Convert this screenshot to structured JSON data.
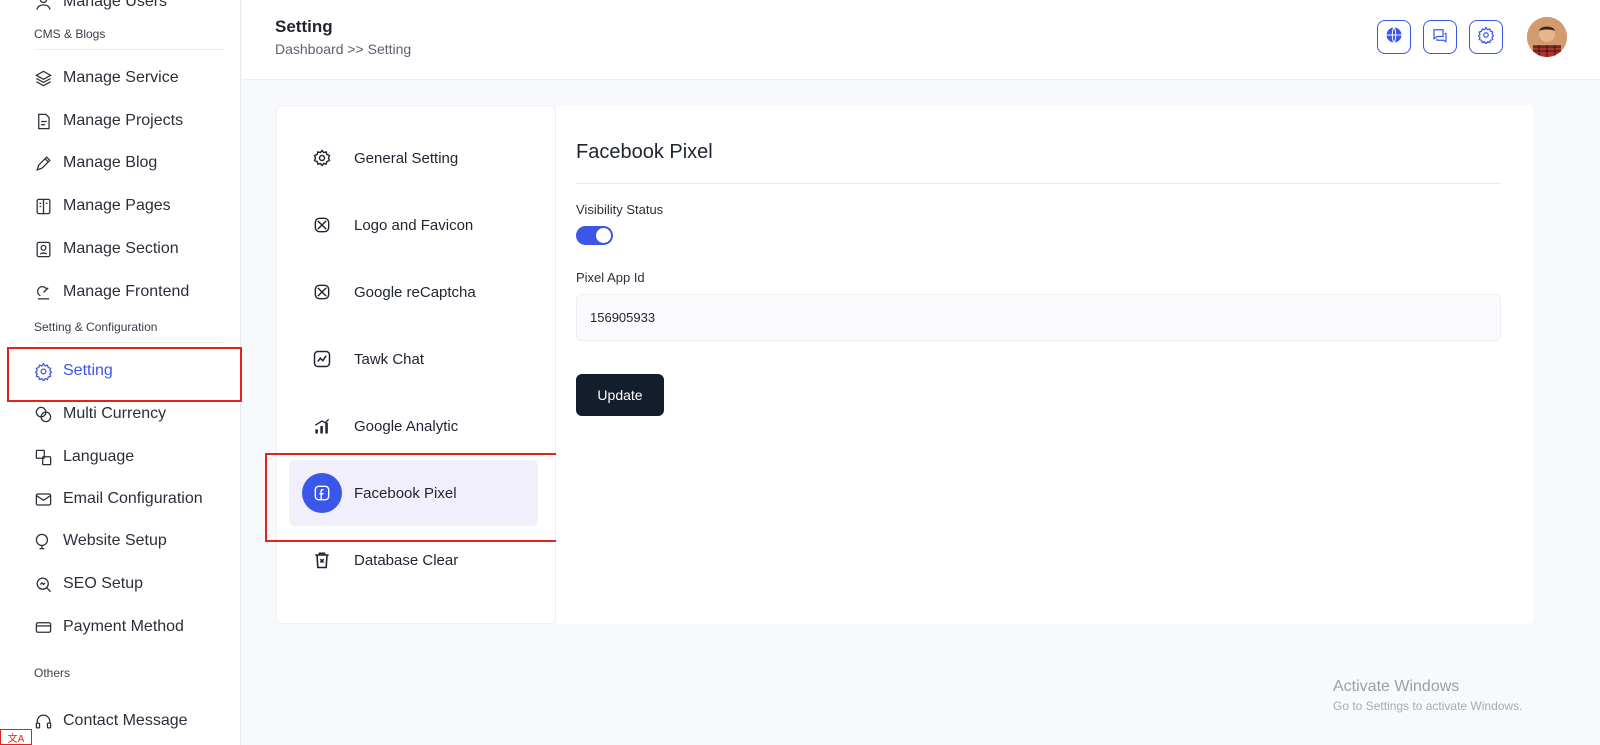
{
  "sidebar": {
    "top_partial_label": "Manage Users",
    "sections": {
      "cms": "CMS & Blogs",
      "setting": "Setting & Configuration",
      "others": "Others"
    },
    "items": [
      {
        "label": "Manage Service",
        "icon": "stack-icon"
      },
      {
        "label": "Manage Projects",
        "icon": "project-icon"
      },
      {
        "label": "Manage Blog",
        "icon": "blog-icon"
      },
      {
        "label": "Manage Pages",
        "icon": "pages-icon"
      },
      {
        "label": "Manage Section",
        "icon": "section-icon"
      },
      {
        "label": "Manage Frontend",
        "icon": "frontend-icon"
      },
      {
        "label": "Setting",
        "icon": "gear-icon",
        "active": true
      },
      {
        "label": "Multi Currency",
        "icon": "currency-icon"
      },
      {
        "label": "Language",
        "icon": "language-icon"
      },
      {
        "label": "Email Configuration",
        "icon": "email-icon"
      },
      {
        "label": "Website Setup",
        "icon": "website-icon"
      },
      {
        "label": "SEO Setup",
        "icon": "seo-icon"
      },
      {
        "label": "Payment Method",
        "icon": "payment-icon"
      },
      {
        "label": "Contact Message",
        "icon": "headset-icon"
      }
    ]
  },
  "header": {
    "title": "Setting",
    "breadcrumb": "Dashboard >> Setting",
    "buttons": [
      "globe-icon",
      "chat-icon",
      "gear-icon"
    ]
  },
  "settings_menu": [
    {
      "label": "General Setting",
      "icon": "gear-icon"
    },
    {
      "label": "Logo and Favicon",
      "icon": "image-icon"
    },
    {
      "label": "Google reCaptcha",
      "icon": "captcha-icon"
    },
    {
      "label": "Tawk Chat",
      "icon": "chart-icon"
    },
    {
      "label": "Google Analytic",
      "icon": "analytics-icon"
    },
    {
      "label": "Facebook Pixel",
      "icon": "facebook-icon",
      "active": true
    },
    {
      "label": "Database Clear",
      "icon": "trash-icon"
    }
  ],
  "content": {
    "title": "Facebook Pixel",
    "visibility_label": "Visibility Status",
    "visibility_on": true,
    "pixel_label": "Pixel App Id",
    "pixel_value": "156905933",
    "update_label": "Update"
  },
  "watermark": {
    "title": "Activate Windows",
    "subtitle": "Go to Settings to activate Windows."
  },
  "colors": {
    "accent": "#3b57e9",
    "dark": "#141d2b",
    "highlight": "#e2231a",
    "active_bg": "#f1effc"
  }
}
